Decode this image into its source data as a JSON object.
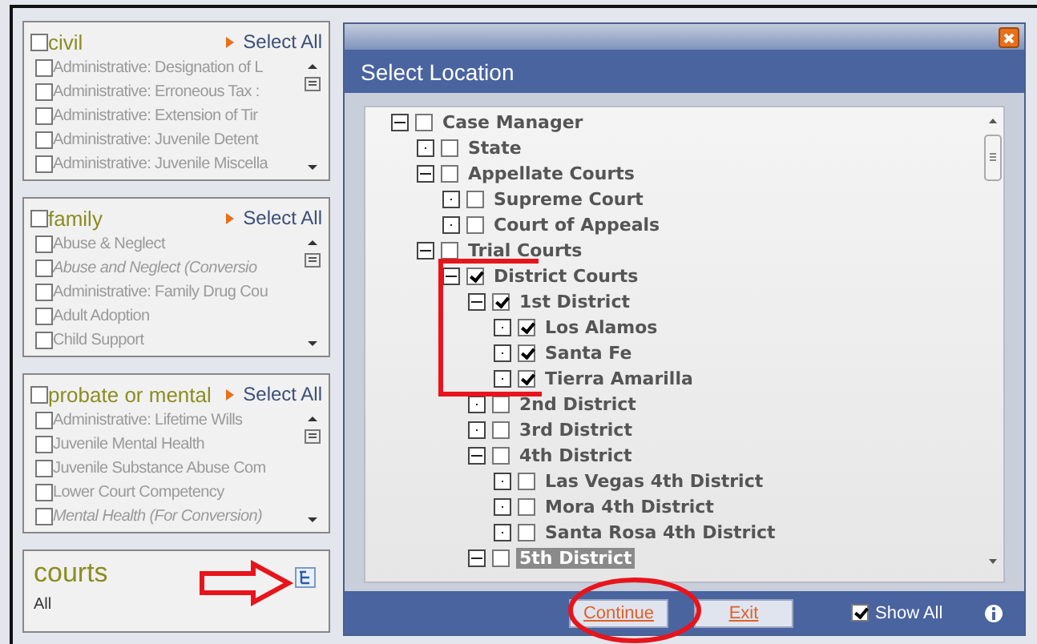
{
  "groups": [
    {
      "title": "civil",
      "checked": false,
      "select_all": "Select All",
      "items": [
        {
          "label": "Administrative: Designation of L",
          "italic": false,
          "checked": false
        },
        {
          "label": "Administrative: Erroneous Tax :",
          "italic": false,
          "checked": false
        },
        {
          "label": "Administrative: Extension of Tir",
          "italic": false,
          "checked": false
        },
        {
          "label": "Administrative: Juvenile Detent",
          "italic": false,
          "checked": false
        },
        {
          "label": "Administrative: Juvenile Miscella",
          "italic": false,
          "checked": false
        }
      ]
    },
    {
      "title": "family",
      "checked": false,
      "select_all": "Select All",
      "items": [
        {
          "label": "Abuse & Neglect",
          "italic": false,
          "checked": false
        },
        {
          "label": "Abuse and Neglect (Conversio",
          "italic": true,
          "checked": false
        },
        {
          "label": "Administrative: Family Drug Cou",
          "italic": false,
          "checked": false
        },
        {
          "label": "Adult Adoption",
          "italic": false,
          "checked": false
        },
        {
          "label": "Child Support",
          "italic": false,
          "checked": false
        }
      ]
    },
    {
      "title": "probate or mental",
      "checked": false,
      "select_all": "Select All",
      "items": [
        {
          "label": "Administrative: Lifetime Wills",
          "italic": false,
          "checked": false
        },
        {
          "label": "Juvenile Mental Health",
          "italic": false,
          "checked": false
        },
        {
          "label": "Juvenile Substance Abuse Com",
          "italic": false,
          "checked": false
        },
        {
          "label": "Lower Court Competency",
          "italic": false,
          "checked": false
        },
        {
          "label": "Mental Health (For Conversion)",
          "italic": true,
          "checked": false
        }
      ]
    }
  ],
  "courts": {
    "title": "courts",
    "value": "All"
  },
  "dialog": {
    "title": "Select Location",
    "tree": [
      {
        "label": "Case Manager",
        "expanded": true,
        "checked": false,
        "selected": false,
        "children": [
          {
            "label": "State",
            "expanded": false,
            "checked": false,
            "selected": false
          },
          {
            "label": "Appellate Courts",
            "expanded": true,
            "checked": false,
            "selected": false,
            "children": [
              {
                "label": "Supreme Court",
                "expanded": false,
                "checked": false,
                "selected": false
              },
              {
                "label": "Court of Appeals",
                "expanded": false,
                "checked": false,
                "selected": false
              }
            ]
          },
          {
            "label": "Trial Courts",
            "expanded": true,
            "checked": false,
            "selected": false,
            "children": [
              {
                "label": "District Courts",
                "expanded": true,
                "checked": true,
                "selected": false,
                "children": [
                  {
                    "label": "1st District",
                    "expanded": true,
                    "checked": true,
                    "selected": false,
                    "children": [
                      {
                        "label": "Los Alamos",
                        "expanded": false,
                        "checked": true,
                        "selected": false
                      },
                      {
                        "label": "Santa Fe",
                        "expanded": false,
                        "checked": true,
                        "selected": false
                      },
                      {
                        "label": "Tierra Amarilla",
                        "expanded": false,
                        "checked": true,
                        "selected": false
                      }
                    ]
                  },
                  {
                    "label": "2nd District",
                    "expanded": false,
                    "checked": false,
                    "selected": false
                  },
                  {
                    "label": "3rd District",
                    "expanded": false,
                    "checked": false,
                    "selected": false
                  },
                  {
                    "label": "4th District",
                    "expanded": true,
                    "checked": false,
                    "selected": false,
                    "children": [
                      {
                        "label": "Las Vegas 4th District",
                        "expanded": false,
                        "checked": false,
                        "selected": false
                      },
                      {
                        "label": "Mora 4th District",
                        "expanded": false,
                        "checked": false,
                        "selected": false
                      },
                      {
                        "label": "Santa Rosa 4th District",
                        "expanded": false,
                        "checked": false,
                        "selected": false
                      }
                    ]
                  },
                  {
                    "label": "5th District",
                    "expanded": true,
                    "checked": false,
                    "selected": true
                  }
                ]
              }
            ]
          }
        ]
      }
    ],
    "buttons": [
      "Continue",
      "Exit"
    ],
    "show_all": {
      "label": "Show All",
      "checked": true
    }
  }
}
